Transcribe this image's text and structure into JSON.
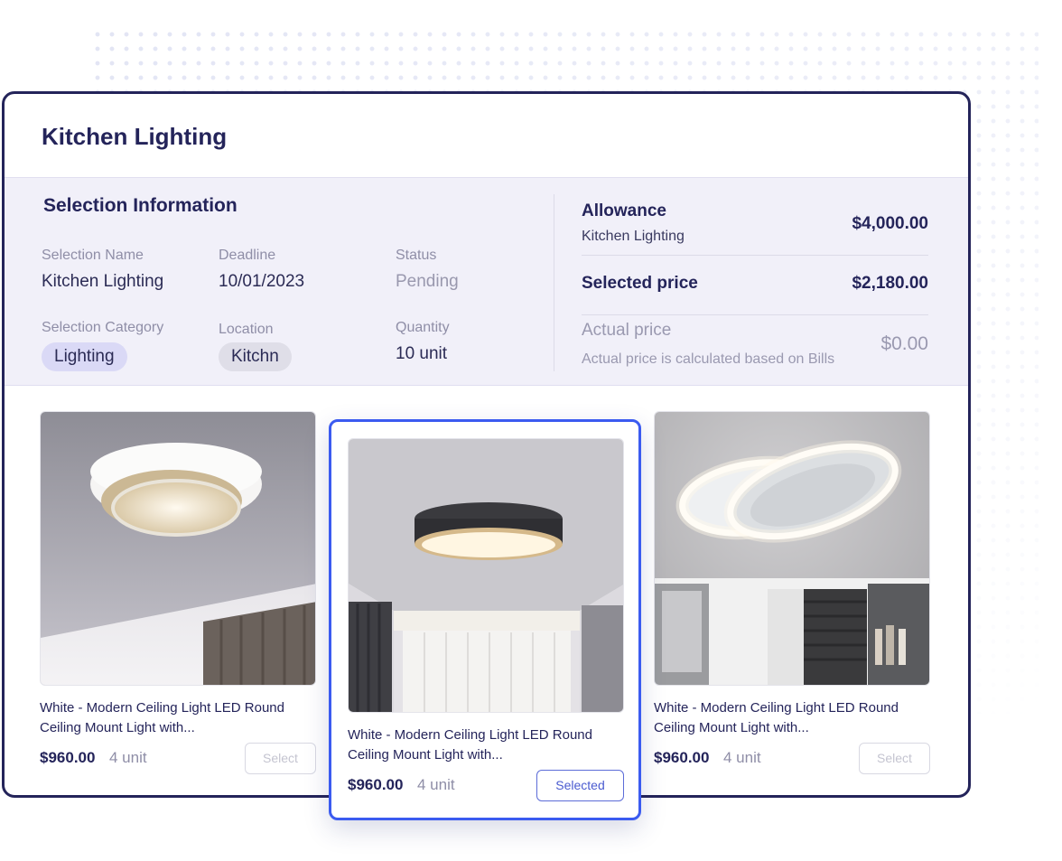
{
  "window": {
    "title": "Kitchen Lighting"
  },
  "selection_info": {
    "title": "Selection Information",
    "fields": {
      "selection_name": {
        "label": "Selection Name",
        "value": "Kitchen Lighting"
      },
      "deadline": {
        "label": "Deadline",
        "value": "10/01/2023"
      },
      "status": {
        "label": "Status",
        "value": "Pending"
      },
      "selection_category": {
        "label": "Selection Category",
        "value": "Lighting"
      },
      "location": {
        "label": "Location",
        "value": "Kitchn"
      },
      "quantity": {
        "label": "Quantity",
        "value": "10 unit"
      }
    }
  },
  "pricing": {
    "allowance": {
      "label": "Allowance",
      "sub": "Kitchen Lighting",
      "amount": "$4,000.00"
    },
    "selected_price": {
      "label": "Selected price",
      "amount": "$2,180.00"
    },
    "actual_price": {
      "label": "Actual price",
      "sub": "Actual price is calculated based on Bills",
      "amount": "$0.00"
    }
  },
  "products": [
    {
      "desc": "White - Modern Ceiling Light LED Round Ceiling Mount Light with...",
      "price": "$960.00",
      "unit": "4 unit",
      "button": "Select",
      "image": "double-ring-ceiling-light"
    },
    {
      "desc": "White - Modern Ceiling Light LED Round Ceiling Mount Light with...",
      "price": "$960.00",
      "unit": "4 unit",
      "button": "Selected",
      "image": "black-drum-ceiling-light"
    },
    {
      "desc": "White - Modern Ceiling Light LED Round Ceiling Mount Light with...",
      "price": "$960.00",
      "unit": "4 unit",
      "button": "Select",
      "image": "oval-ring-ceiling-light"
    }
  ],
  "colors": {
    "accent": "#3b5bf0",
    "frame": "#24245a",
    "band": "#f1f0f9"
  }
}
